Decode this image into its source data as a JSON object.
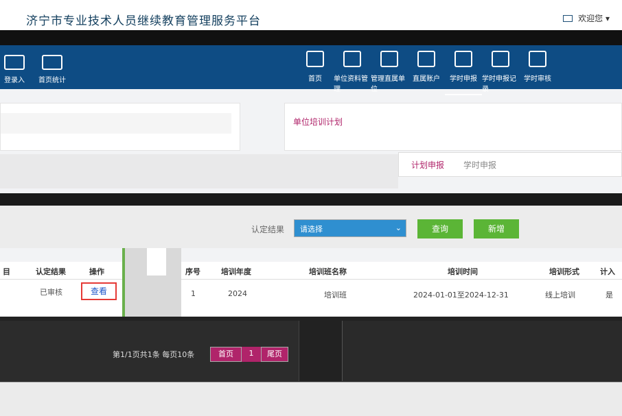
{
  "header": {
    "site_title": "济宁市专业技术人员继续教育管理服务平台",
    "user_label": "欢迎您"
  },
  "nav": {
    "left_items": [
      {
        "label": "登录入",
        "icon": "document-icon"
      },
      {
        "label": "首页统计",
        "icon": "chart-icon"
      }
    ],
    "items": [
      {
        "label": "首页",
        "icon": "home-icon"
      },
      {
        "label": "单位资料管理",
        "icon": "folder-icon"
      },
      {
        "label": "管理直属单位",
        "icon": "building-icon"
      },
      {
        "label": "直属账户",
        "icon": "user-icon"
      },
      {
        "label": "学时申报",
        "icon": "report-icon",
        "active": true
      },
      {
        "label": "学时申报记录",
        "icon": "record-icon"
      },
      {
        "label": "学时审核",
        "icon": "audit-icon"
      }
    ]
  },
  "right_card": {
    "title": "单位培训计划"
  },
  "tabs": [
    {
      "label": "计划申报",
      "active": true
    },
    {
      "label": "学时申报",
      "active": false
    }
  ],
  "filter": {
    "label": "认定结果",
    "select_value": "请选择",
    "query_label": "查询",
    "add_label": "新增"
  },
  "left_table": {
    "headers": [
      "目",
      "认定结果",
      "操作"
    ],
    "row": {
      "result": "已审核",
      "view_label": "查看"
    }
  },
  "right_table": {
    "headers": [
      "序号",
      "培训年度",
      "培训班名称",
      "培训时间",
      "培训形式",
      "计入"
    ],
    "rows": [
      [
        "1",
        "2024",
        "培训班",
        "2024-01-01至2024-12-31",
        "线上培训",
        "是"
      ]
    ]
  },
  "pager": {
    "info": "第1/1页共1条 每页10条",
    "first_label": "首页",
    "current_page": "1",
    "last_label": "尾页"
  },
  "colors": {
    "nav_blue": "#0e4c84",
    "accent_magenta": "#b0246a",
    "green": "#5bb536",
    "view_border": "#e53935"
  }
}
